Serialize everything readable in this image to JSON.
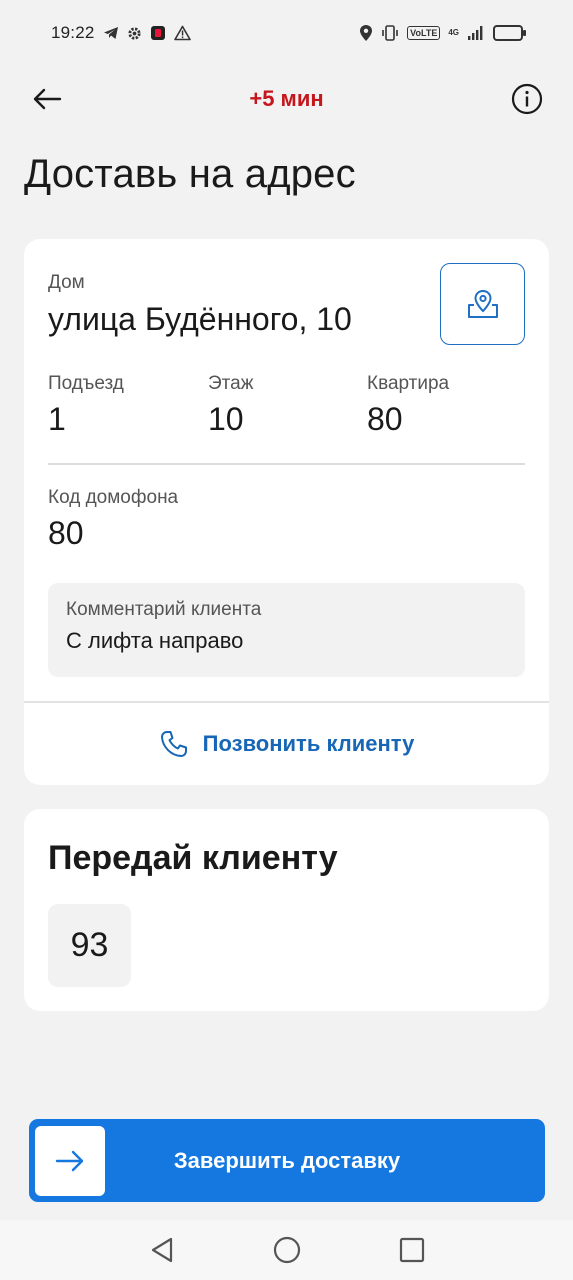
{
  "status_bar": {
    "time": "19:22",
    "left_icons": [
      "telegram-icon",
      "settings-icon",
      "app-notification-icon",
      "warning-icon"
    ],
    "right_icons": [
      "location-icon",
      "vibrate-icon",
      "volte-icon",
      "network-4g-icon",
      "signal-icon",
      "battery-icon"
    ],
    "volte_label": "VoLTE",
    "network_label": "4G"
  },
  "top_bar": {
    "timer": "+5 мин",
    "timer_color": "#c4161c"
  },
  "page_title": "Доставь на адрес",
  "address": {
    "house_label": "Дом",
    "house_value": "улица Будённого, 10",
    "entrance_label": "Подъезд",
    "entrance_value": "1",
    "floor_label": "Этаж",
    "floor_value": "10",
    "apartment_label": "Квартира",
    "apartment_value": "80",
    "intercom_label": "Код домофона",
    "intercom_value": "80",
    "comment_label": "Комментарий клиента",
    "comment_value": "С лифта направо",
    "call_label": "Позвонить клиенту"
  },
  "handover": {
    "title": "Передай клиенту",
    "code": "93"
  },
  "finish_button": {
    "label": "Завершить доставку",
    "color": "#1478e0"
  },
  "colors": {
    "accent_blue": "#1767b6",
    "background": "#f2f2f2"
  }
}
